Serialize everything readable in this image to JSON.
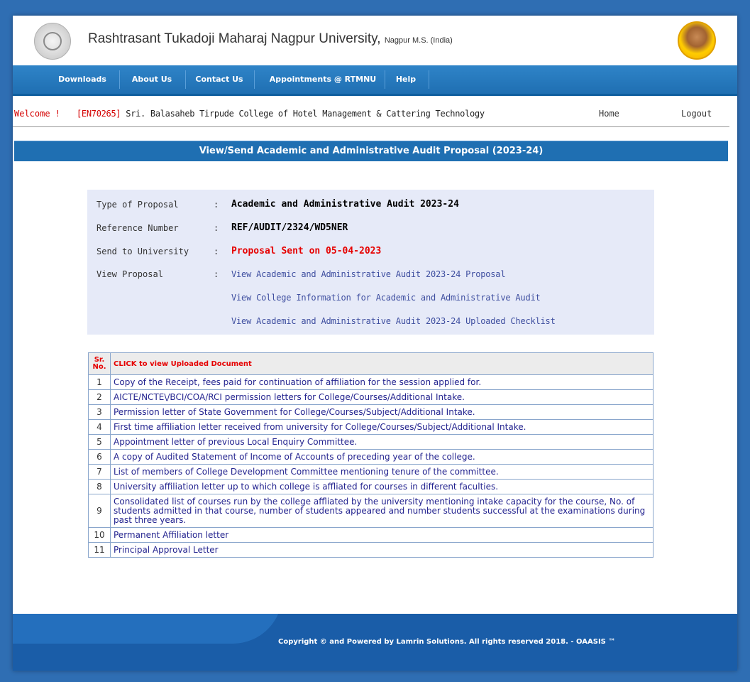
{
  "header": {
    "university_name": "Rashtrasant Tukadoji Maharaj Nagpur University,",
    "location": "Nagpur M.S. (India)"
  },
  "nav": {
    "items": [
      "Downloads",
      "About Us",
      "Contact Us",
      "Appointments @ RTMNU",
      "Help"
    ]
  },
  "welcome": {
    "label": "Welcome !",
    "code": "[EN70265]",
    "college": "Sri. Balasaheb Tirpude College of Hotel Management & Cattering Technology",
    "home": "Home",
    "logout": "Logout"
  },
  "page_title": "View/Send Academic and Administrative Audit Proposal (2023-24)",
  "proposal": {
    "type_label": "Type of Proposal",
    "type_value": "Academic and Administrative Audit 2023-24",
    "ref_label": "Reference Number",
    "ref_value": "REF/AUDIT/2324/WD5NER",
    "send_label": "Send to University",
    "send_value": "Proposal Sent on 05-04-2023",
    "view_label": "View Proposal",
    "colon": ":",
    "links": [
      "View Academic and Administrative Audit 2023-24 Proposal",
      "View College Information for Academic and Administrative Audit",
      "View Academic and Administrative Audit 2023-24 Uploaded Checklist"
    ]
  },
  "documents": {
    "col_sr_1": "Sr.",
    "col_sr_2": "No.",
    "col_doc": "CLICK to view Uploaded Document",
    "rows": [
      {
        "no": "1",
        "text": "Copy of the Receipt, fees paid for continuation of affiliation for the session applied for."
      },
      {
        "no": "2",
        "text": "AICTE/NCTE\\/BCI/COA/RCI permission letters for College/Courses/Additional Intake."
      },
      {
        "no": "3",
        "text": "Permission letter of State Government for College/Courses/Subject/Additional Intake."
      },
      {
        "no": "4",
        "text": "First time affiliation letter received from university for College/Courses/Subject/Additional Intake."
      },
      {
        "no": "5",
        "text": "Appointment letter of previous Local Enquiry Committee."
      },
      {
        "no": "6",
        "text": "A copy of Audited Statement of Income of Accounts of preceding year of the college."
      },
      {
        "no": "7",
        "text": "List of members of College Development Committee mentioning tenure of the committee."
      },
      {
        "no": "8",
        "text": "University affiliation letter up to which college is affliated for courses in different faculties."
      },
      {
        "no": "9",
        "text": "Consolidated list of courses run by the college affliated by the university mentioning intake capacity for the course, No. of students admitted in that course, number of students appeared and number students successful at the examinations during past three years."
      },
      {
        "no": "10",
        "text": "Permanent Affiliation letter"
      },
      {
        "no": "11",
        "text": "Principal Approval Letter"
      }
    ]
  },
  "footer": {
    "text": "Copyright © and Powered by Lamrin Solutions. All rights reserved 2018. - OAASIS ™"
  },
  "colors": {
    "nav_blue": "#1f6fb2",
    "page_bg": "#2f6eb3",
    "accent_red": "#e60000",
    "link_blue": "#3f4fa0"
  },
  "icons": [
    "university-logo-icon",
    "founder-portrait-icon"
  ]
}
